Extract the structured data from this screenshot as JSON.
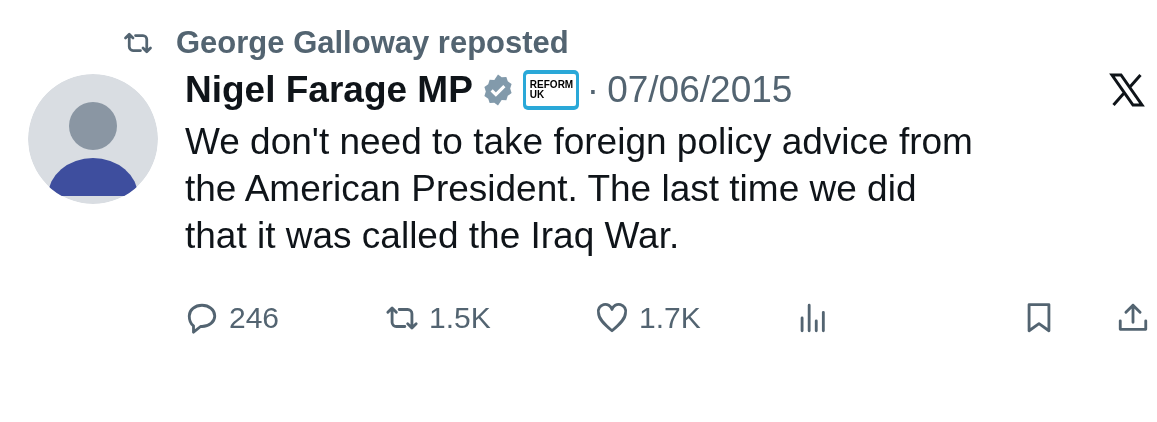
{
  "repost": {
    "text": "George Galloway reposted"
  },
  "author": {
    "name": "Nigel Farage MP",
    "verified": true,
    "affiliate_badge": {
      "line_1": "REFORM",
      "line_2": "UK"
    }
  },
  "separator": "·",
  "date": "07/06/2015",
  "text_lines": [
    "We don't need to take foreign policy advice from",
    "the American President. The last time we did",
    "that it was called the Iraq War."
  ],
  "actions": [
    {
      "kind": "reply",
      "count": "246"
    },
    {
      "kind": "repost",
      "count": "1.5K"
    },
    {
      "kind": "like",
      "count": "1.7K"
    },
    {
      "kind": "views"
    },
    {
      "kind": "bookmark"
    },
    {
      "kind": "share"
    }
  ]
}
